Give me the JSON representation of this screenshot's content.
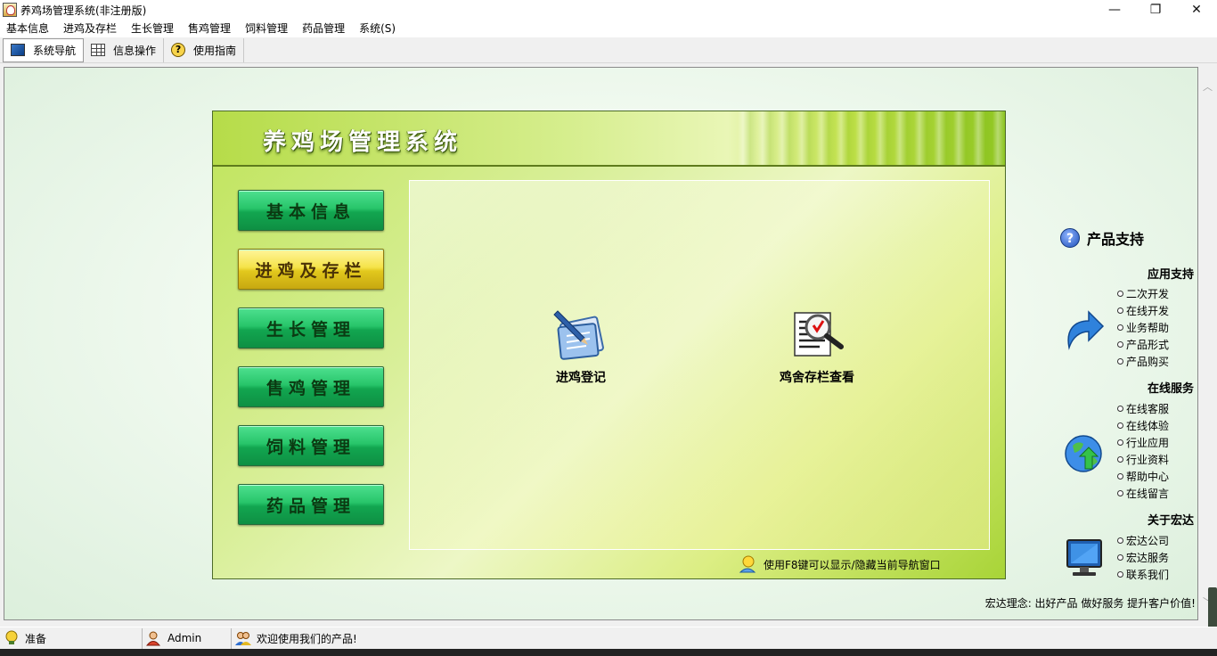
{
  "window": {
    "title": "养鸡场管理系统(非注册版)",
    "minimize": "—",
    "maximize": "❐",
    "close": "✕"
  },
  "menu": [
    "基本信息",
    "进鸡及存栏",
    "生长管理",
    "售鸡管理",
    "饲料管理",
    "药品管理",
    "系统(S)"
  ],
  "toolbar": {
    "nav_label": "系统导航",
    "info_label": "信息操作",
    "guide_label": "使用指南",
    "help_glyph": "?"
  },
  "panel": {
    "title": "养鸡场管理系统",
    "nav_buttons": [
      "基本信息",
      "进鸡及存栏",
      "生长管理",
      "售鸡管理",
      "饲料管理",
      "药品管理"
    ],
    "selected_index": 1,
    "functions": [
      {
        "label": "进鸡登记",
        "icon": "notepad-pen-icon"
      },
      {
        "label": "鸡舍存栏查看",
        "icon": "magnifier-document-icon"
      }
    ],
    "hint": "使用F8键可以显示/隐藏当前导航窗口"
  },
  "side": {
    "title": "产品支持",
    "q_glyph": "?",
    "app_support": {
      "title": "应用支持",
      "links": [
        "二次开发",
        "在线开发",
        "业务帮助",
        "产品形式",
        "产品购买"
      ]
    },
    "online_service": {
      "title": "在线服务",
      "links": [
        "在线客服",
        "在线体验",
        "行业应用",
        "行业资料",
        "帮助中心",
        "在线留言"
      ]
    },
    "about": {
      "title": "关于宏达",
      "links": [
        "宏达公司",
        "宏达服务",
        "联系我们"
      ]
    },
    "slogan": "宏达理念: 出好产品  做好服务  提升客户价值!"
  },
  "status": {
    "ready": "准备",
    "user": "Admin",
    "welcome": "欢迎使用我们的产品!"
  },
  "scroll": {
    "up": "︿",
    "down": "﹀"
  },
  "colors": {
    "nav_green": "#1fb85f",
    "nav_selected_yellow": "#f0d838",
    "panel_green": "#bfe45a"
  }
}
